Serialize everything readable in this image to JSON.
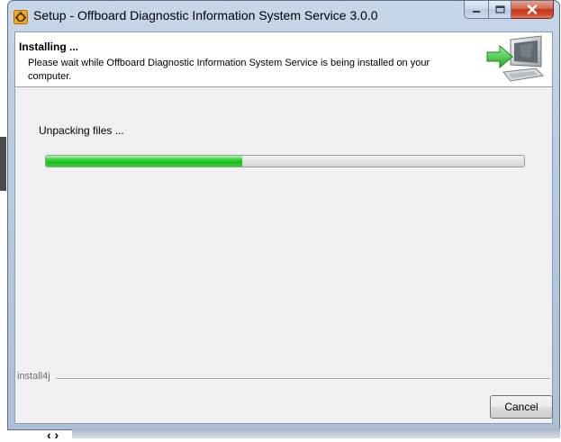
{
  "window": {
    "title": "Setup - Offboard Diagnostic Information System Service 3.0.0",
    "icon": "app-engine-icon",
    "caption_buttons": [
      "minimize-icon",
      "maximize-icon",
      "close-icon"
    ]
  },
  "header": {
    "title": "Installing ...",
    "description": "Please wait while Offboard Diagnostic Information System Service is being installed on your computer.",
    "graphic": "install-to-computer-icon"
  },
  "status": {
    "text": "Unpacking files ...",
    "progress_fraction": 0.41
  },
  "footer": {
    "brand": "install4j",
    "cancel_label": "Cancel"
  },
  "colors": {
    "progress_fill": "#18c018",
    "accent_arrow": "#3cc83c",
    "close_button": "#c1381d"
  }
}
